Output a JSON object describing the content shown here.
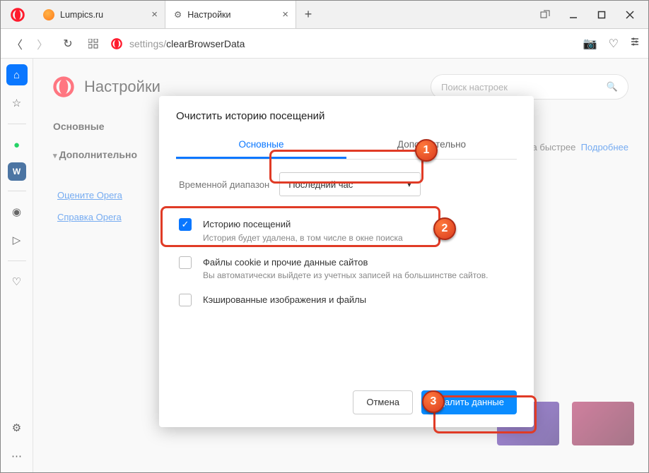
{
  "tabs": [
    {
      "title": "Lumpics.ru"
    },
    {
      "title": "Настройки"
    }
  ],
  "address": {
    "prefix": "settings/",
    "path": "clearBrowserData"
  },
  "settings": {
    "title": "Настройки",
    "search_placeholder": "Поиск настроек",
    "nav_basic": "Основные",
    "nav_advanced": "Дополнительно",
    "link_rate": "Оцените Opera",
    "link_help": "Справка Opera",
    "note_tail": "аза быстрее",
    "note_more": "Подробнее"
  },
  "dialog": {
    "title": "Очистить историю посещений",
    "tab_basic": "Основные",
    "tab_advanced": "Дополнительно",
    "range_label": "Временной диапазон",
    "range_value": "Последний час",
    "opt1_title": "Историю посещений",
    "opt1_sub": "История будет удалена, в том числе в окне поиска",
    "opt2_title": "Файлы cookie и прочие данные сайтов",
    "opt2_sub": "Вы автоматически выйдете из учетных записей на большинстве сайтов.",
    "opt3_title": "Кэшированные изображения и файлы",
    "cancel": "Отмена",
    "confirm": "Удалить данные"
  },
  "callouts": {
    "c1": "1",
    "c2": "2",
    "c3": "3"
  }
}
